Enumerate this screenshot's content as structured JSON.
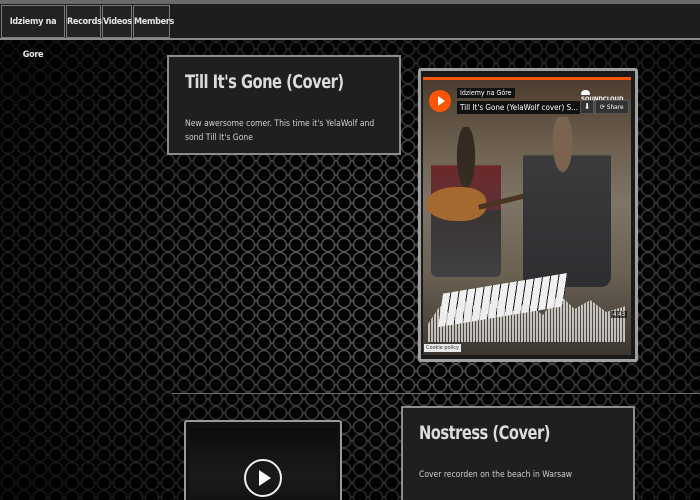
{
  "nav": {
    "items": [
      {
        "label": "Idziemy na Gore"
      },
      {
        "label": "Records"
      },
      {
        "label": "Videos"
      },
      {
        "label": "Members"
      }
    ]
  },
  "posts": [
    {
      "title": "Till It's Gone (Cover)",
      "description": "New awersome comer. This time it's YelaWolf and sond Till It's Gone"
    },
    {
      "title": "Nostress (Cover)",
      "description": "Cover recorden on the beach in Warsaw"
    }
  ],
  "player": {
    "user": "Idziemy na Góre",
    "track": "Till It's Gone (YelaWolf cover) S...",
    "brand": "SOUNDCLOUD",
    "share_label": "Share",
    "time": "4:43",
    "cookie_label": "Cookie policy",
    "accent_color": "#ff5500"
  }
}
